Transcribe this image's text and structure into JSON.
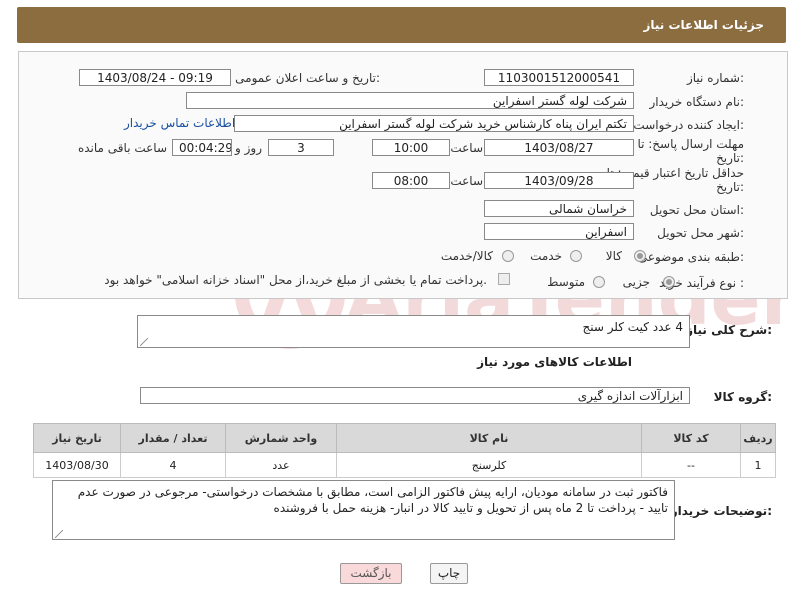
{
  "header": {
    "title": "جزئیات اطلاعات نیاز"
  },
  "form": {
    "need_number_label": "شماره نیاز:",
    "need_number": "1103001512000541",
    "announce_label": "تاریخ و ساعت اعلان عمومی:",
    "announce_value": "1403/08/24 - 09:19",
    "buyer_org_label": "نام دستگاه خریدار:",
    "buyer_org": "شرکت لوله گستر اسفراین",
    "creator_label": "ایجاد کننده درخواست:",
    "creator": "تکتم ایران پناه کارشناس خرید شرکت لوله گستر اسفراین",
    "contact_link": "اطلاعات تماس خریدار",
    "send_deadline_label_1": "مهلت ارسال پاسخ: تا",
    "send_deadline_label_2": "تاریخ:",
    "send_date": "1403/08/27",
    "time_label": "ساعت",
    "send_time": "10:00",
    "days": "3",
    "days_label": "روز و",
    "remaining": "00:04:29",
    "remaining_label": "ساعت باقی مانده",
    "price_deadline_label_1": "حداقل تاریخ اعتبار قیمت: تا",
    "price_deadline_label_2": "تاریخ:",
    "price_date": "1403/09/28",
    "price_time": "08:00",
    "province_label": "استان محل تحویل:",
    "province": "خراسان شمالی",
    "city_label": "شهر محل تحویل:",
    "city": "اسفراین",
    "category_label": "طبقه بندی موضوعی:",
    "category_options": [
      "کالا",
      "خدمت",
      "کالا/خدمت"
    ],
    "purchase_type_label": "نوع فرآیند خرید :",
    "purchase_options": [
      "جزیی",
      "متوسط"
    ],
    "payment_note": "پرداخت تمام یا بخشی از مبلغ خرید،از محل \"اسناد خزانه اسلامی\" خواهد بود."
  },
  "description": {
    "label": "شرح کلی نیاز:",
    "value": "4 عدد کیت کلر سنج"
  },
  "goods": {
    "section_title": "اطلاعات کالاهای مورد نیاز",
    "group_label": "گروه کالا:",
    "group_value": "ابزارآلات اندازه گیری",
    "columns": [
      "ردیف",
      "کد کالا",
      "نام کالا",
      "واحد شمارش",
      "تعداد / مقدار",
      "تاریخ نیاز"
    ],
    "rows": [
      [
        "1",
        "--",
        "کلرسنج",
        "عدد",
        "4",
        "1403/08/30"
      ]
    ]
  },
  "buyer_notes": {
    "label": "توضیحات خریدار:",
    "value": "فاکتور ثبت در سامانه مودیان، ارایه پیش فاکتور الزامی است، مطابق با مشخصات درخواستی- مرجوعی در صورت عدم تایید - پرداخت تا 2 ماه پس از تحویل و تایید کالا در انبار- هزینه حمل با فروشنده"
  },
  "buttons": {
    "print": "چاپ",
    "back": "بازگشت"
  },
  "watermark": {
    "text": "AriaTender.neT"
  },
  "colors": {
    "header_bg": "#8b6d40",
    "link": "#1a4fa0",
    "back_btn_bg": "#f9d9d9",
    "watermark": "#e8b9b9"
  }
}
